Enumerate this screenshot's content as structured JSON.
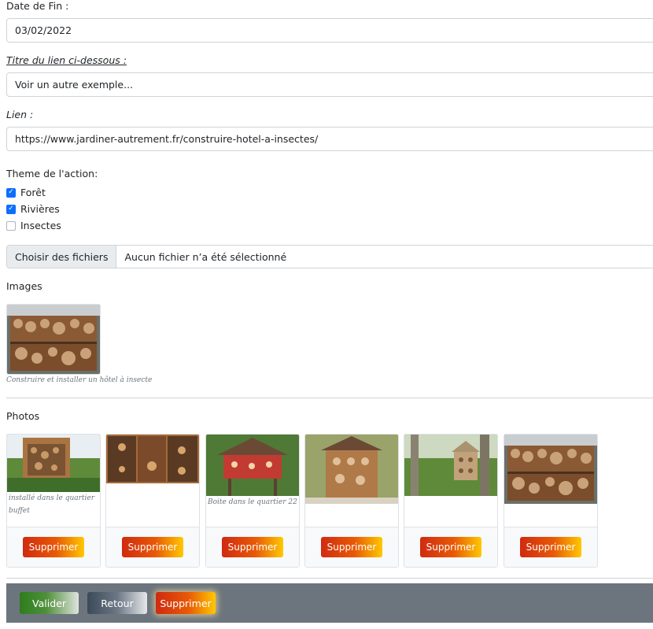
{
  "form": {
    "date_fin_label": "Date de Fin :",
    "date_fin_value": "03/02/2022",
    "titre_lien_label": "Titre du lien ci-dessous :",
    "titre_lien_value": "Voir un autre exemple...",
    "lien_label": "Lien :",
    "lien_value": "https://www.jardiner-autrement.fr/construire-hotel-a-insectes/",
    "theme_label": "Theme de l'action:",
    "themes": [
      {
        "label": "Forêt",
        "checked": true
      },
      {
        "label": "Rivières",
        "checked": true
      },
      {
        "label": "Insectes",
        "checked": false
      }
    ],
    "file_button": "Choisir des fichiers",
    "file_status": "Aucun fichier n’a été sélectionné"
  },
  "images": {
    "heading": "Images",
    "items": [
      {
        "caption": "Construire et installer un hôtel à insecte"
      }
    ]
  },
  "photos": {
    "heading": "Photos",
    "delete_label": "Supprimer",
    "items": [
      {
        "caption": "installé dans le quartier buffet"
      },
      {
        "caption": ""
      },
      {
        "caption": "Boite dans le quartier 22"
      },
      {
        "caption": ""
      },
      {
        "caption": ""
      },
      {
        "caption": ""
      }
    ]
  },
  "actions": {
    "valider": "Valider",
    "retour": "Retour",
    "supprimer": "Supprimer"
  },
  "colors": {
    "checkbox_accent": "#0d6efd",
    "action_bar": "#6c757d",
    "delete_gradient_start": "#d02a10",
    "delete_gradient_end": "#ffc800"
  }
}
